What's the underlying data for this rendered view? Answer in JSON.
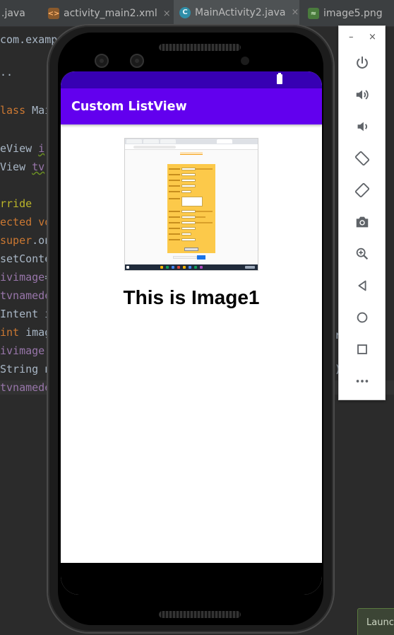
{
  "ide": {
    "tabs": [
      {
        "label": ".java",
        "icon": ""
      },
      {
        "label": "activity_main2.xml",
        "icon": "xml-file-icon"
      },
      {
        "label": "MainActivity2.java",
        "icon": "java-class-icon"
      },
      {
        "label": "image5.png",
        "icon": "image-file-icon"
      }
    ],
    "close_glyph": "×",
    "code_lines": [
      {
        "frag": [
          [
            "com.examp",
            "pl"
          ]
        ]
      },
      {
        "frag": [
          [
            "..",
            "pl"
          ]
        ]
      },
      {
        "frag": [
          [
            "lass ",
            "kw"
          ],
          [
            "Mai",
            "pl"
          ]
        ]
      },
      {
        "frag": [
          [
            "eView ",
            "pl"
          ],
          [
            "i",
            "fd"
          ]
        ]
      },
      {
        "frag": [
          [
            "View ",
            "pl"
          ],
          [
            "tv",
            "fd"
          ]
        ]
      },
      {
        "frag": [
          [
            "rride",
            "an"
          ]
        ]
      },
      {
        "frag": [
          [
            "ected ",
            "kw"
          ],
          [
            "vo",
            "kw"
          ]
        ]
      },
      {
        "frag": [
          [
            "super",
            "kw"
          ],
          [
            ".on",
            "pl"
          ]
        ]
      },
      {
        "frag": [
          [
            "setConte",
            "pl"
          ]
        ]
      },
      {
        "frag": [
          [
            "ivimage",
            "fd"
          ],
          [
            "=",
            "pl"
          ]
        ]
      },
      {
        "frag": [
          [
            "tvnamede",
            "fd"
          ]
        ]
      },
      {
        "frag": [
          [
            "Intent ",
            "pl"
          ],
          [
            "i",
            "pl"
          ]
        ]
      },
      {
        "frag": [
          [
            "int ",
            "kw"
          ],
          [
            "imag",
            "pl"
          ]
        ]
      },
      {
        "frag": [
          [
            "ivimage",
            "fd"
          ]
        ]
      },
      {
        "frag": [
          [
            "String ",
            "pl"
          ],
          [
            "n",
            "pl"
          ]
        ]
      },
      {
        "frag": [
          [
            "tvnamede",
            "fd"
          ]
        ]
      }
    ],
    "right_fragments": [
      "r",
      ".i",
      ")"
    ]
  },
  "app": {
    "title": "Custom ListView",
    "caption": "This is Image1",
    "colors": {
      "status_bar": "#3700b3",
      "app_bar": "#6200ee"
    }
  },
  "emulator_toolbar": {
    "window_controls": [
      "–",
      "×"
    ],
    "buttons": [
      "power-icon",
      "volume-up-icon",
      "volume-down-icon",
      "rotate-left-icon",
      "rotate-right-icon",
      "screenshot-icon",
      "zoom-icon",
      "back-icon",
      "home-icon",
      "overview-icon",
      "more-icon"
    ]
  },
  "launch_popup": {
    "text": "Launc"
  }
}
